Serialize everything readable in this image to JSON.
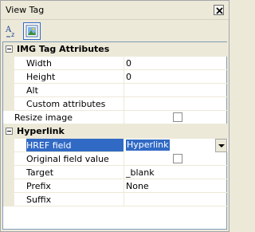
{
  "window": {
    "title": "View Tag",
    "close_icon": "close-icon"
  },
  "toolbar": {
    "buttons": [
      {
        "icon": "sorted-text-icon",
        "active": false
      },
      {
        "icon": "image-icon",
        "active": true
      }
    ]
  },
  "properties": {
    "img_tag": {
      "label": "IMG Tag Attributes",
      "rows": [
        {
          "name": "Width",
          "value": "0"
        },
        {
          "name": "Height",
          "value": "0"
        },
        {
          "name": "Alt",
          "value": ""
        },
        {
          "name": "Custom attributes",
          "value": ""
        }
      ]
    },
    "resize_image": {
      "name": "Resize image",
      "checked": false
    },
    "hyperlink": {
      "label": "Hyperlink",
      "href_field": {
        "name": "HREF field",
        "value": "Hyperlink"
      },
      "original_field_value": {
        "name": "Original field value",
        "checked": false
      },
      "target": {
        "name": "Target",
        "value": "_blank"
      },
      "prefix": {
        "name": "Prefix",
        "value": "None"
      },
      "suffix": {
        "name": "Suffix",
        "value": ""
      }
    }
  },
  "colors": {
    "selection": "#316ac5",
    "panel": "#ece9d8"
  }
}
